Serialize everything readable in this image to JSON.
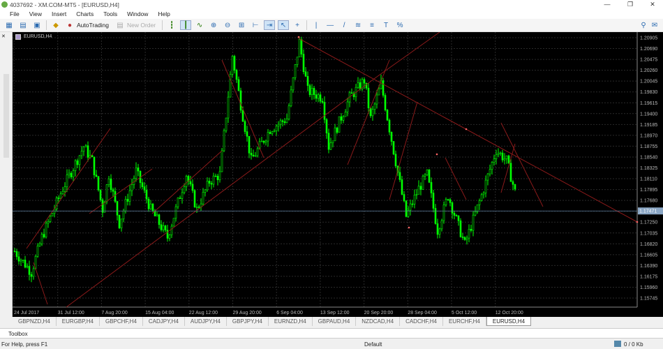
{
  "window": {
    "title": "4037692 - XM.COM-MT5 - [EURUSD,H4]",
    "controls": [
      "—",
      "❐",
      "✕"
    ]
  },
  "menu": [
    "File",
    "View",
    "Insert",
    "Charts",
    "Tools",
    "Window",
    "Help"
  ],
  "toolbar": {
    "autotrading_label": "AutoTrading",
    "new_order_label": "New Order"
  },
  "chart": {
    "label": "EURUSD,H4",
    "current_price": "1.17471",
    "colors": {
      "background": "#000000",
      "candle": "#00ff00",
      "trendline": "#8b1a1a",
      "grid": "#2a2a2a"
    },
    "price_ticks": [
      "1.20905",
      "1.20690",
      "1.20475",
      "1.20260",
      "1.20045",
      "1.19830",
      "1.19615",
      "1.19400",
      "1.19185",
      "1.18970",
      "1.18755",
      "1.18540",
      "1.18325",
      "1.18110",
      "1.17895",
      "1.17680",
      "1.17465",
      "1.17250",
      "1.17035",
      "1.16820",
      "1.16605",
      "1.16390",
      "1.16175",
      "1.15960",
      "1.15745"
    ],
    "time_ticks": [
      "24 Jul 2017",
      "31 Jul 12:00",
      "7 Aug 20:00",
      "15 Aug 04:00",
      "22 Aug 12:00",
      "29 Aug 20:00",
      "6 Sep 04:00",
      "13 Sep 12:00",
      "20 Sep 20:00",
      "28 Sep 04:00",
      "5 Oct 12:00",
      "12 Oct 20:00"
    ]
  },
  "chart_data": {
    "type": "candlestick",
    "symbol": "EURUSD",
    "timeframe": "H4",
    "ylim": [
      1.1553,
      1.2112
    ],
    "price_path": [
      [
        0,
        1.16672
      ],
      [
        8,
        1.16257
      ],
      [
        13,
        1.16948
      ],
      [
        23,
        1.17917
      ],
      [
        33,
        1.18747
      ],
      [
        37,
        1.1847
      ],
      [
        42,
        1.17502
      ],
      [
        45,
        1.18194
      ],
      [
        50,
        1.17225
      ],
      [
        58,
        1.18263
      ],
      [
        65,
        1.17502
      ],
      [
        73,
        1.16948
      ],
      [
        82,
        1.18194
      ],
      [
        87,
        1.17502
      ],
      [
        93,
        1.18055
      ],
      [
        98,
        1.18194
      ],
      [
        104,
        1.20545
      ],
      [
        108,
        1.19577
      ],
      [
        113,
        1.1847
      ],
      [
        122,
        1.19093
      ],
      [
        130,
        1.193
      ],
      [
        136,
        1.20822
      ],
      [
        140,
        1.19854
      ],
      [
        147,
        1.19715
      ],
      [
        150,
        1.18747
      ],
      [
        160,
        1.19715
      ],
      [
        167,
        1.20061
      ],
      [
        170,
        1.193
      ],
      [
        175,
        1.19992
      ],
      [
        180,
        1.18885
      ],
      [
        187,
        1.17364
      ],
      [
        193,
        1.17917
      ],
      [
        197,
        1.18194
      ],
      [
        202,
        1.17087
      ],
      [
        207,
        1.17779
      ],
      [
        215,
        1.1681
      ],
      [
        223,
        1.17779
      ],
      [
        230,
        1.18678
      ],
      [
        235,
        1.1847
      ],
      [
        239,
        1.17848
      ]
    ]
  },
  "tabs": [
    "GBPNZD,H4",
    "EURGBP,H4",
    "GBPCHF,H4",
    "CADJPY,H4",
    "AUDJPY,H4",
    "GBPJPY,H4",
    "EURNZD,H4",
    "GBPAUD,H4",
    "NZDCAD,H4",
    "CADCHF,H4",
    "EURCHF,H4",
    "EURUSD,H4"
  ],
  "active_tab": "EURUSD,H4",
  "toolbox": {
    "label": "Toolbox"
  },
  "status": {
    "help": "For Help, press F1",
    "profile": "Default",
    "traffic": "0 / 0 Kb"
  }
}
